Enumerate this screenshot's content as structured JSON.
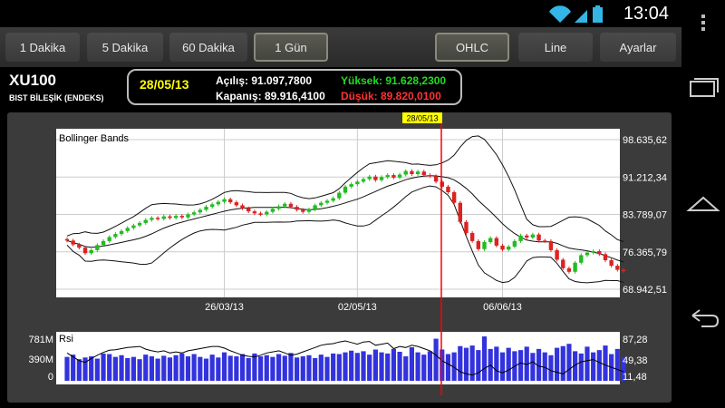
{
  "status_bar": {
    "clock": "13:04",
    "icons": [
      "wifi-icon",
      "signal-icon",
      "battery-icon"
    ]
  },
  "toolbar": {
    "buttons": [
      {
        "label": "1 Dakika",
        "active": false
      },
      {
        "label": "5 Dakika",
        "active": false
      },
      {
        "label": "60 Dakika",
        "active": false
      },
      {
        "label": "1 Gün",
        "active": true
      },
      {
        "label": "OHLC",
        "active": true
      },
      {
        "label": "Line",
        "active": false
      },
      {
        "label": "Ayarlar",
        "active": false
      }
    ]
  },
  "header": {
    "symbol": "XU100",
    "description": "BIST  BİLEŞİK (ENDEKS)",
    "date": "28/05/13",
    "open": "Açılış: 91.097,7800",
    "close": "Kapanış: 89.916,4100",
    "high": "Yüksek: 91.628,2300",
    "low": "Düşük: 89.820,0100"
  },
  "colors": {
    "up": "#22bb22",
    "down": "#dd2222",
    "cursor": "#ff0000",
    "volume": "#3333dd"
  },
  "chart_data": [
    {
      "type": "candlestick",
      "title": "Bollinger Bands",
      "cursor_label": "28/05/13",
      "x_ticks": [
        "26/03/13",
        "02/05/13",
        "06/06/13"
      ],
      "y_ticks": [
        "98.635,62",
        "91.212,34",
        "83.789,07",
        "76.365,79",
        "68.942,51"
      ],
      "ylim": [
        68942.51,
        98635.62
      ],
      "close": [
        78600,
        77800,
        77200,
        76100,
        76700,
        77700,
        78500,
        79300,
        79900,
        80500,
        81100,
        81600,
        82100,
        82700,
        83100,
        82900,
        83400,
        83100,
        83500,
        83200,
        83800,
        84200,
        84700,
        85300,
        85800,
        86300,
        86800,
        86200,
        85600,
        85000,
        84400,
        84000,
        83800,
        84300,
        84900,
        85400,
        85900,
        85300,
        84700,
        84300,
        84800,
        85600,
        86100,
        86500,
        87000,
        88100,
        89300,
        89800,
        90300,
        90800,
        91300,
        90600,
        91200,
        91600,
        91100,
        91700,
        92400,
        91800,
        92300,
        91600,
        91400,
        90300,
        89300,
        88200,
        86100,
        82300,
        80100,
        78500,
        76900,
        78300,
        79100,
        77600,
        76800,
        77400,
        78500,
        79600,
        79200,
        79800,
        78600,
        78500,
        76700,
        74800,
        73100,
        72400,
        74200,
        75700,
        76200,
        76500,
        75900,
        74700,
        73600,
        72800,
        72500
      ]
    },
    {
      "type": "bar+line",
      "title": "Rsi",
      "volume_ticks": [
        "781M",
        "390M",
        "0"
      ],
      "rsi_ticks": [
        "87,28",
        "49,38",
        "11,48"
      ],
      "volume_ylim": [
        0,
        781
      ],
      "rsi_ylim": [
        11.48,
        87.28
      ],
      "volume": [
        420,
        460,
        380,
        410,
        430,
        390,
        480,
        470,
        420,
        450,
        400,
        420,
        380,
        460,
        430,
        390,
        440,
        410,
        450,
        480,
        430,
        470,
        420,
        390,
        460,
        410,
        500,
        440,
        430,
        470,
        400,
        480,
        430,
        450,
        420,
        470,
        440,
        490,
        410,
        430,
        450,
        400,
        460,
        420,
        480,
        470,
        500,
        530,
        490,
        520,
        460,
        550,
        500,
        480,
        560,
        510,
        430,
        590,
        500,
        460,
        520,
        740,
        550,
        470,
        500,
        610,
        580,
        620,
        540,
        780,
        560,
        600,
        500,
        580,
        520,
        540,
        600,
        490,
        560,
        500,
        450,
        580,
        610,
        650,
        520,
        480,
        600,
        500,
        540,
        620,
        470,
        560,
        420
      ],
      "rsi": [
        62,
        55,
        48,
        45,
        52,
        58,
        63,
        67,
        68,
        70,
        72,
        73,
        74,
        69,
        66,
        64,
        66,
        62,
        64,
        62,
        66,
        68,
        70,
        72,
        74,
        74,
        71,
        66,
        62,
        58,
        56,
        55,
        58,
        62,
        64,
        66,
        62,
        58,
        60,
        64,
        68,
        72,
        76,
        78,
        79,
        82,
        84,
        81,
        78,
        82,
        83,
        76,
        78,
        80,
        70,
        74,
        72,
        76,
        74,
        70,
        66,
        58,
        48,
        42,
        36,
        28,
        24,
        22,
        26,
        34,
        40,
        30,
        26,
        31,
        38,
        44,
        41,
        46,
        38,
        36,
        30,
        27,
        24,
        32,
        40,
        46,
        48,
        50,
        45,
        40,
        36,
        32,
        28
      ]
    }
  ]
}
